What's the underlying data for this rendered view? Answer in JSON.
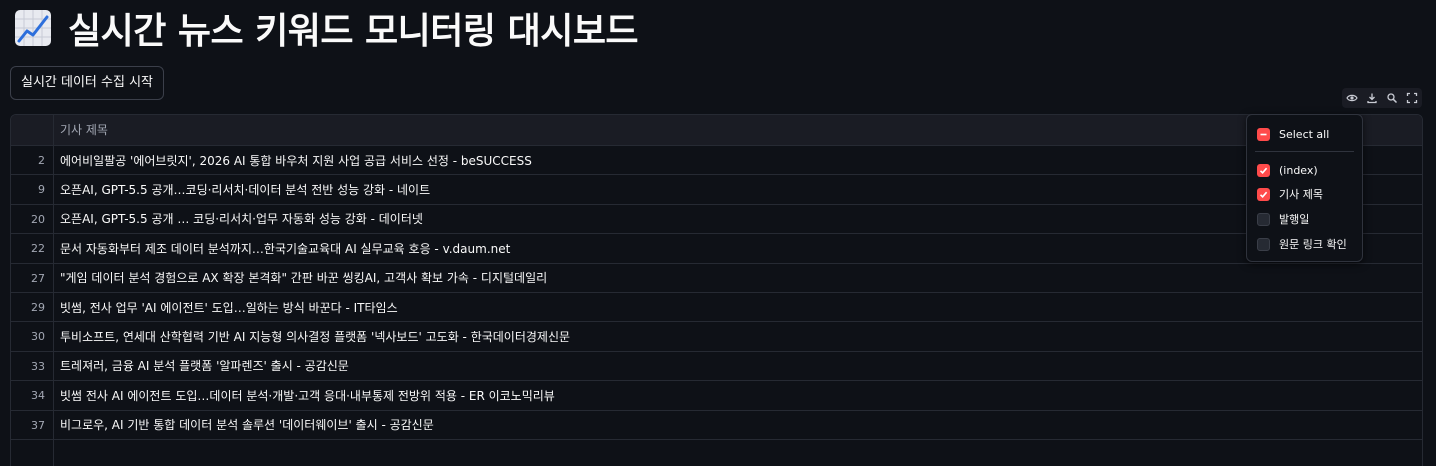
{
  "header": {
    "title": "실시간 뉴스 키워드 모니터링 대시보드",
    "icon": "chart-increasing-icon"
  },
  "controls": {
    "start_label": "실시간 데이터 수집 시작"
  },
  "toolbar": {
    "icons": [
      "eye-icon",
      "download-icon",
      "search-icon",
      "fullscreen-icon"
    ]
  },
  "table": {
    "column_header": "기사 제목",
    "rows": [
      {
        "index": "2",
        "title": "에어비일팔공 '에어브릿지', 2026 AI 통합 바우처 지원 사업 공급 서비스 선정 - beSUCCESS"
      },
      {
        "index": "9",
        "title": "오픈AI, GPT-5.5 공개…코딩·리서치·데이터 분석 전반 성능 강화 - 네이트"
      },
      {
        "index": "20",
        "title": "오픈AI, GPT-5.5 공개 … 코딩·리서치·업무 자동화 성능 강화 - 데이터넷"
      },
      {
        "index": "22",
        "title": "문서 자동화부터 제조 데이터 분석까지…한국기술교육대 AI 실무교육 호응 - v.daum.net"
      },
      {
        "index": "27",
        "title": "\"게임 데이터 분석 경험으로 AX 확장 본격화\" 간판 바꾼 씽킹AI, 고객사 확보 가속 - 디지털데일리"
      },
      {
        "index": "29",
        "title": "빗썸, 전사 업무 'AI 에이전트' 도입…일하는 방식 바꾼다 - IT타임스"
      },
      {
        "index": "30",
        "title": "투비소프트, 연세대 산학협력 기반 AI 지능형 의사결정 플랫폼 '넥사보드' 고도화 - 한국데이터경제신문"
      },
      {
        "index": "33",
        "title": "트레져러, 금융 AI 분석 플랫폼 '알파렌즈' 출시 - 공감신문"
      },
      {
        "index": "34",
        "title": "빗썸 전사 AI 에이전트 도입…데이터 분석·개발·고객 응대·내부통제 전방위 적용 - ER 이코노믹리뷰"
      },
      {
        "index": "37",
        "title": "비그로우, AI 기반 통합 데이터 분석 솔루션 '데이터웨이브' 출시 - 공감신문"
      },
      {
        "index": "",
        "title": ""
      }
    ]
  },
  "column_menu": {
    "select_all": "Select all",
    "items": [
      {
        "label": "(index)",
        "checked": true
      },
      {
        "label": "기사 제목",
        "checked": true
      },
      {
        "label": "발행일",
        "checked": false
      },
      {
        "label": "원문 링크 확인",
        "checked": false
      }
    ]
  },
  "colors": {
    "background": "#0e1117",
    "accent": "#ff4b4b",
    "header_bg": "#1a1c24"
  }
}
